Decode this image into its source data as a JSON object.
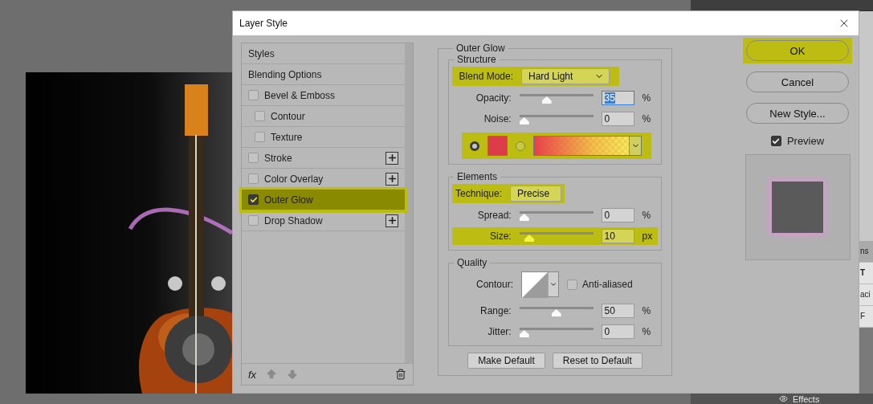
{
  "side_panel": {
    "fragments": [
      "ns",
      "T",
      "aci",
      "F"
    ],
    "effects_label": "Effects"
  },
  "dialog": {
    "title": "Layer Style",
    "styles_list": [
      {
        "label": "Styles",
        "kind": "header",
        "selected": false
      },
      {
        "label": "Blending Options",
        "kind": "header",
        "selected": false
      },
      {
        "label": "Bevel & Emboss",
        "kind": "effect",
        "checked": false,
        "selected": false,
        "addable": false,
        "children": [
          {
            "label": "Contour",
            "kind": "effect",
            "checked": false,
            "selected": false,
            "addable": false
          },
          {
            "label": "Texture",
            "kind": "effect",
            "checked": false,
            "selected": false,
            "addable": false
          }
        ]
      },
      {
        "label": "Stroke",
        "kind": "effect",
        "checked": false,
        "selected": false,
        "addable": true
      },
      {
        "label": "Color Overlay",
        "kind": "effect",
        "checked": false,
        "selected": false,
        "addable": true
      },
      {
        "label": "Outer Glow",
        "kind": "effect",
        "checked": true,
        "selected": true,
        "addable": false
      },
      {
        "label": "Drop Shadow",
        "kind": "effect",
        "checked": false,
        "selected": false,
        "addable": true
      }
    ],
    "list_toolbar": {
      "fx": "fx"
    },
    "outer_glow": {
      "title": "Outer Glow",
      "structure": {
        "title": "Structure",
        "blend_mode": {
          "label": "Blend Mode:",
          "value": "Hard Light",
          "highlighted": true
        },
        "sliders": [
          {
            "label": "Opacity:",
            "value": "35",
            "unit": "%",
            "level": 0.35,
            "focused": true,
            "highlighted": false
          },
          {
            "label": "Noise:",
            "value": "0",
            "unit": "%",
            "level": 0,
            "focused": false,
            "highlighted": false
          }
        ],
        "fill": {
          "highlighted": true,
          "options": [
            {
              "kind": "solid",
              "selected": true
            },
            {
              "kind": "gradient",
              "selected": false
            }
          ]
        }
      },
      "elements": {
        "title": "Elements",
        "technique": {
          "label": "Technique:",
          "value": "Precise",
          "highlighted": true
        },
        "sliders": [
          {
            "label": "Spread:",
            "value": "0",
            "unit": "%",
            "level": 0,
            "focused": false,
            "highlighted": false
          },
          {
            "label": "Size:",
            "value": "10",
            "unit": "px",
            "level": 0.08,
            "focused": false,
            "highlighted": true
          }
        ]
      },
      "quality": {
        "title": "Quality",
        "contour": {
          "label": "Contour:"
        },
        "anti_aliased": {
          "label": "Anti-aliased",
          "checked": false
        },
        "sliders": [
          {
            "label": "Range:",
            "value": "50",
            "unit": "%",
            "level": 0.5,
            "focused": false,
            "highlighted": false
          },
          {
            "label": "Jitter:",
            "value": "0",
            "unit": "%",
            "level": 0,
            "focused": false,
            "highlighted": false
          }
        ]
      },
      "buttons": [
        "Make Default",
        "Reset to Default"
      ]
    },
    "actions": [
      {
        "label": "OK",
        "highlighted": true
      },
      {
        "label": "Cancel",
        "highlighted": false
      },
      {
        "label": "New Style...",
        "highlighted": false
      }
    ],
    "preview": {
      "label": "Preview",
      "checked": true
    }
  }
}
